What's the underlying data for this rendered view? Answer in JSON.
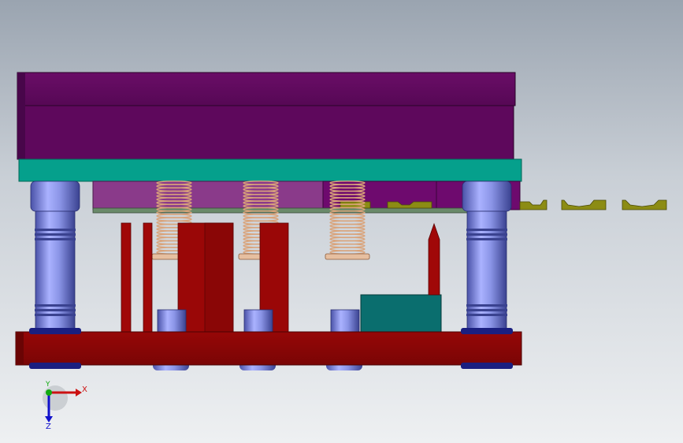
{
  "viewport": {
    "background_top": "#9aa4b0",
    "background_bottom": "#eef0f2"
  },
  "model": {
    "colors": {
      "top_plate": "#600a5d",
      "top_plate_edge": "#3d063b",
      "backing_plate": "#05a08c",
      "stripper_plate": "#8a3a8a",
      "die_inserts": "#6e0a6e",
      "die_base": "#8e0606",
      "punch": "#a00808",
      "guide_pillar": "#8a94e6",
      "spring": "#d9a37a",
      "block": "#0a6e6e",
      "strip_parts": "#8c8c14"
    }
  },
  "triad": {
    "x_label": "X",
    "y_label": "Y",
    "z_label": "Z",
    "x_color": "#cc1111",
    "y_color": "#11aa11",
    "z_color": "#1111cc"
  }
}
